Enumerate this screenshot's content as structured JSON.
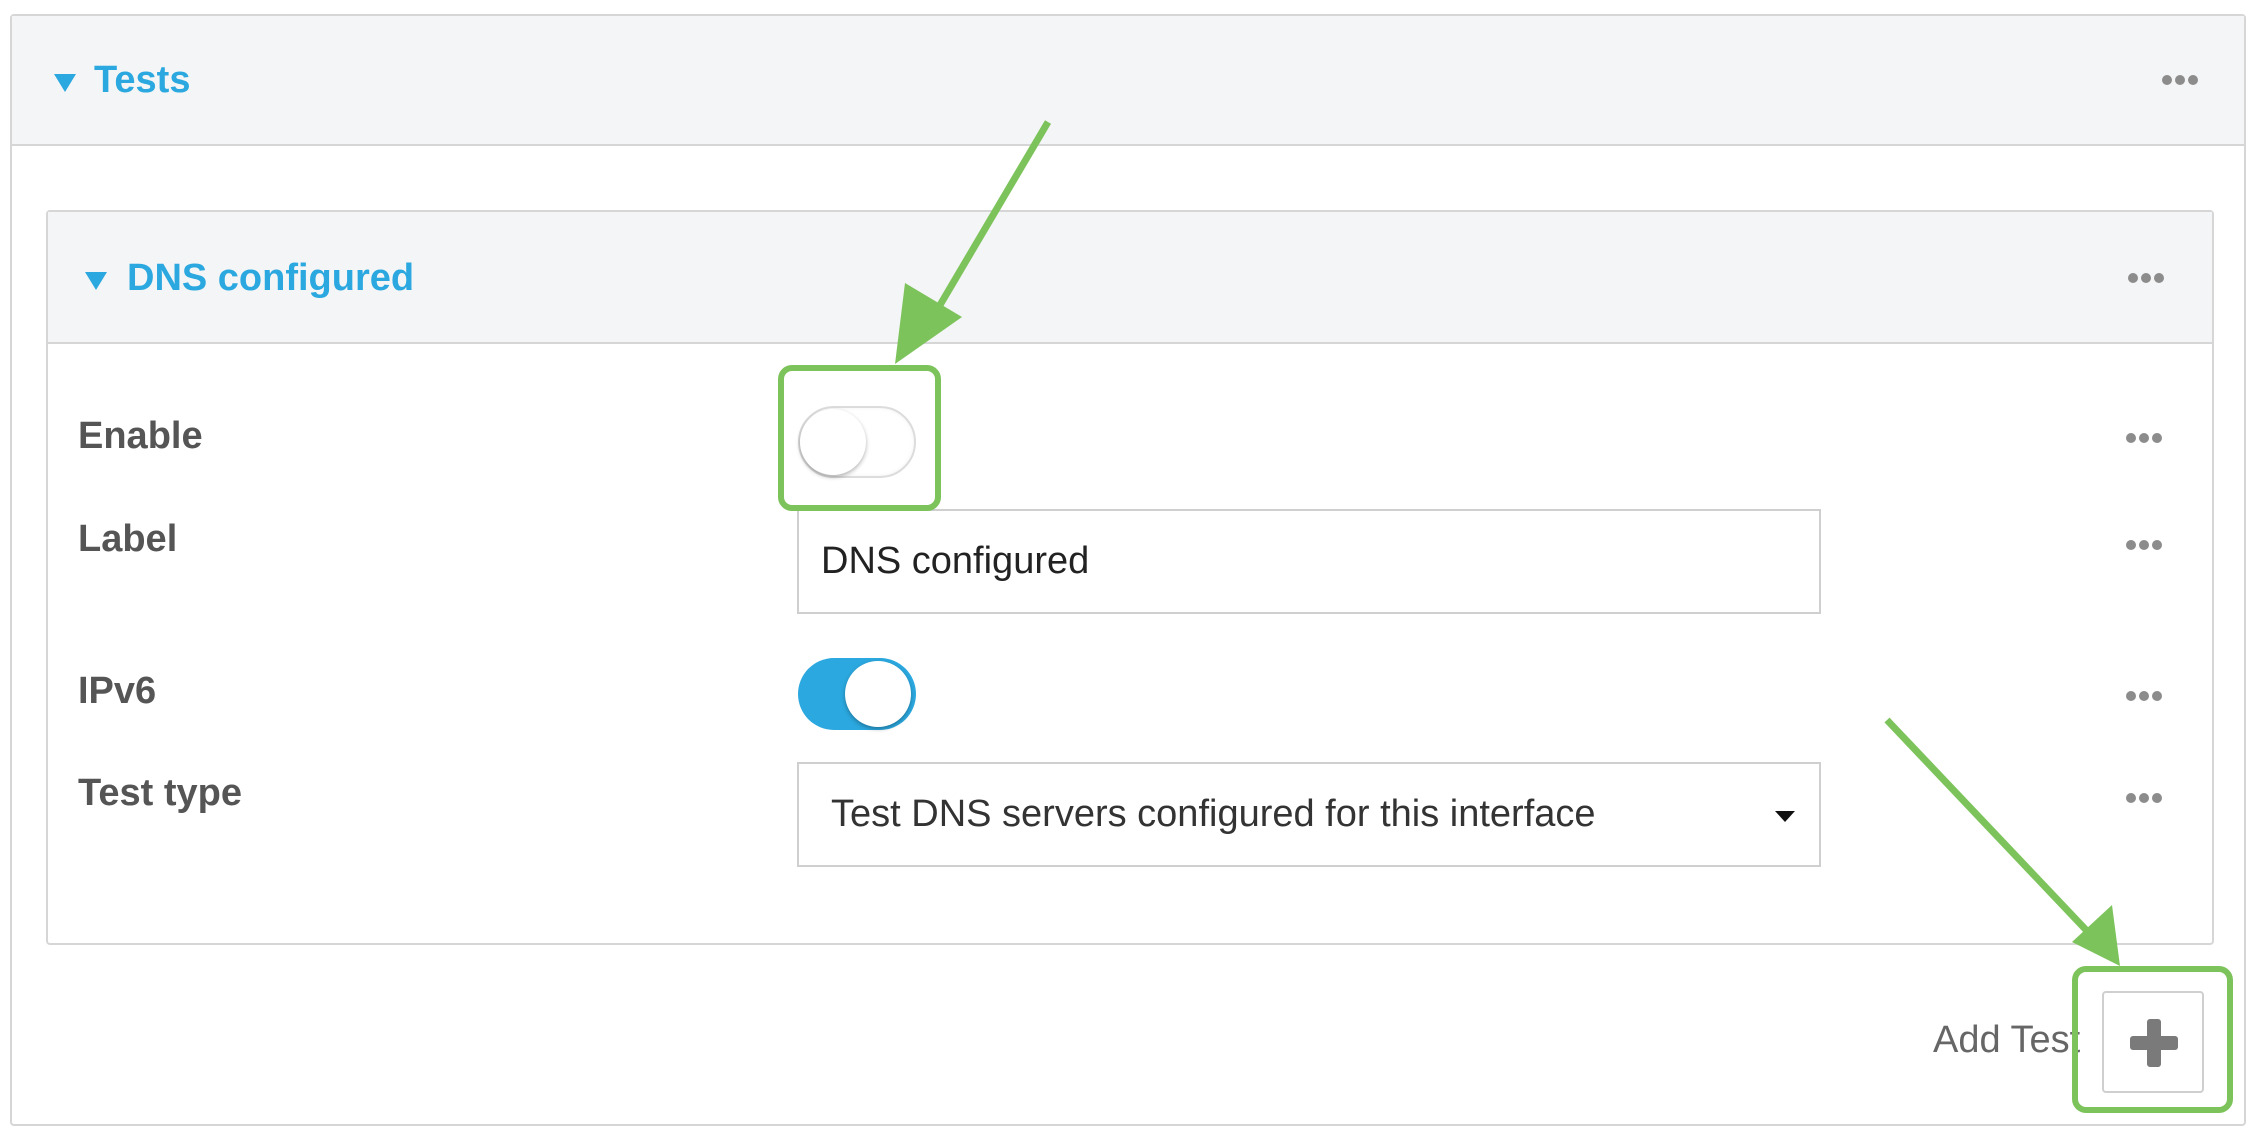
{
  "tests_section": {
    "title": "Tests"
  },
  "test_item": {
    "title": "DNS configured"
  },
  "fields": {
    "enable": {
      "label": "Enable",
      "value": false
    },
    "label": {
      "label": "Label",
      "value": "DNS configured"
    },
    "ipv6": {
      "label": "IPv6",
      "value": true
    },
    "test_type": {
      "label": "Test type",
      "value": "Test DNS servers configured for this interface"
    }
  },
  "add_test": {
    "label": "Add Test"
  },
  "colors": {
    "accent": "#2ba8df",
    "annotation": "#7dc35b",
    "header_bg": "#f4f5f6"
  },
  "icons": {
    "collapse": "caret-down-icon",
    "menu": "more-dots-icon",
    "add": "plus-icon",
    "dropdown": "dropdown-caret-icon"
  }
}
